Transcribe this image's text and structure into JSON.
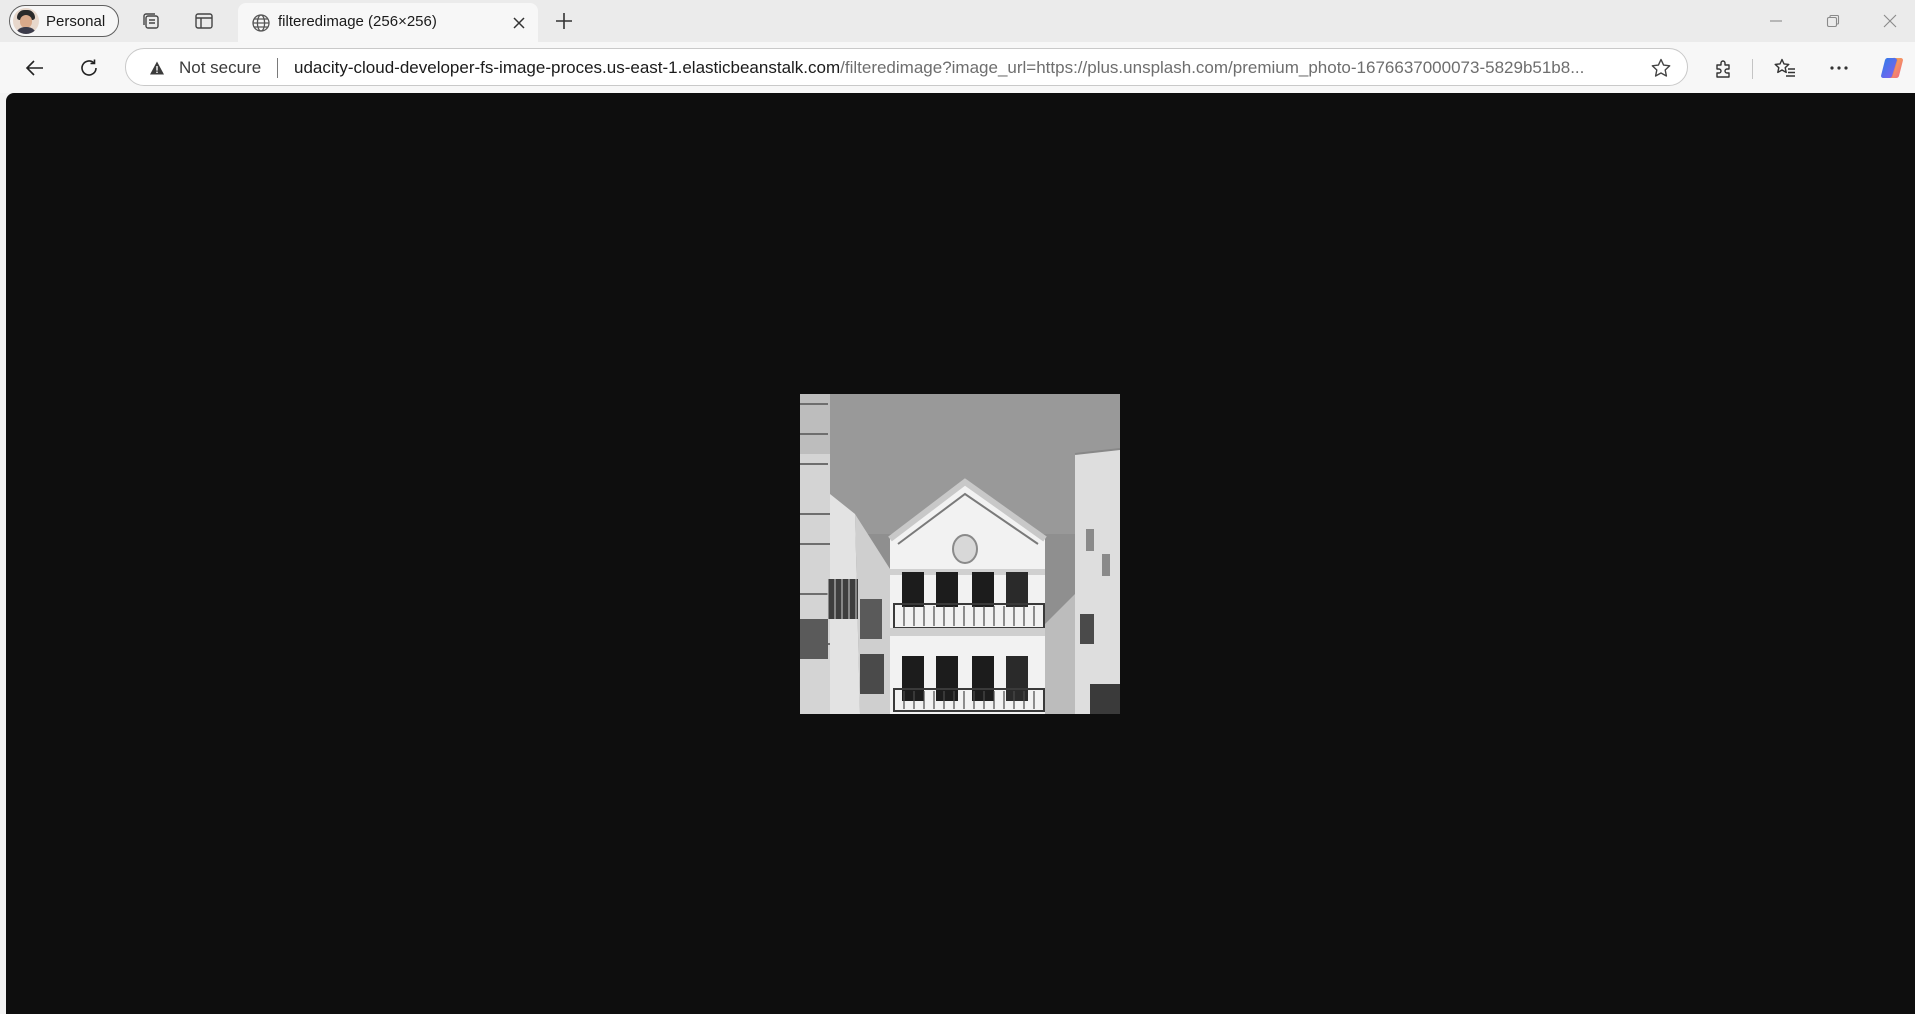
{
  "browser": {
    "profile_label": "Personal",
    "tab": {
      "title": "filteredimage (256×256)",
      "favicon": "globe-icon"
    },
    "address_bar": {
      "security_label": "Not secure",
      "url_host": "udacity-cloud-developer-fs-image-proces.us-east-1.elasticbeanstalk.com",
      "url_path": "/filteredimage?image_url=https://plus.unsplash.com/premium_photo-1676637000073-5829b51b8..."
    },
    "toolbar_icons": [
      "back-icon",
      "reload-icon",
      "star-icon",
      "extensions-icon",
      "favorites-icon",
      "more-icon",
      "copilot-icon"
    ],
    "window_controls": [
      "minimize-icon",
      "restore-icon",
      "close-icon"
    ]
  },
  "page": {
    "background": "#0e0e0e",
    "image": {
      "subject": "grayscale photo of a white building with balconies on a narrow street",
      "filter": "grayscale"
    }
  }
}
